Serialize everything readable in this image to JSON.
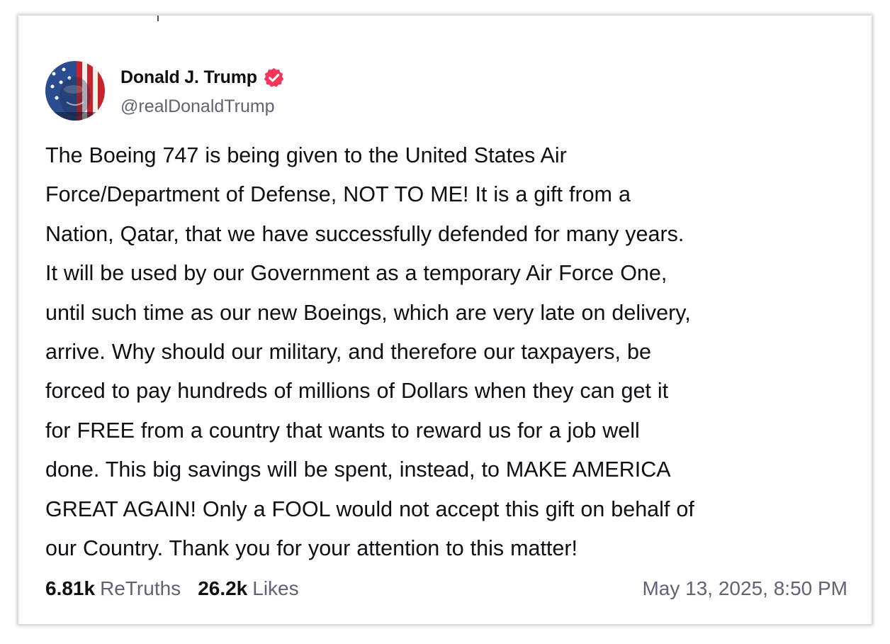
{
  "post": {
    "author": {
      "display_name": "Donald J. Trump",
      "handle": "@realDonaldTrump",
      "verified": true,
      "avatar": "profile-photo"
    },
    "text": "The Boeing 747 is being given to the United States Air\nForce/Department of Defense, NOT TO ME! It is a gift from a\nNation, Qatar, that we have successfully defended for many years.\nIt will be used by our Government as a temporary Air Force One,\nuntil such time as our new Boeings, which are very late on delivery,\narrive. Why should our military, and therefore our taxpayers, be\nforced to pay hundreds of millions of Dollars when they can get it\nfor FREE from a  country that wants to reward us for a job well\ndone. This big savings will be spent, instead, to MAKE AMERICA\nGREAT AGAIN! Only a FOOL would not accept this gift on behalf of\nour Country. Thank you for your attention to this matter!",
    "stats": {
      "retruths_count": "6.81k",
      "retruths_label": "ReTruths",
      "likes_count": "26.2k",
      "likes_label": "Likes"
    },
    "timestamp": "May 13, 2025, 8:50 PM"
  },
  "colors": {
    "verified_badge": "#f4355a",
    "secondary_text": "#606374",
    "primary_text": "#0f0f14"
  },
  "icons": {
    "verified": "verified-badge-icon"
  }
}
